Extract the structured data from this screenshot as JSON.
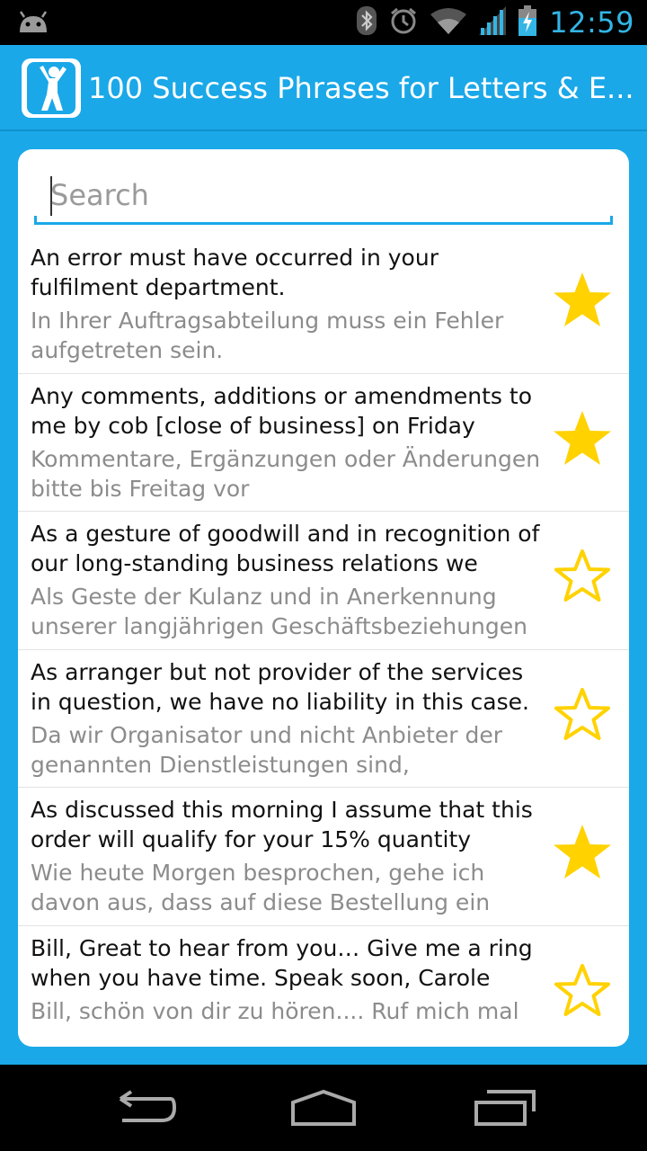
{
  "status_bar": {
    "time": "12:59",
    "icons": [
      "android-icon",
      "bluetooth-icon",
      "alarm-icon",
      "wifi-icon",
      "signal-icon",
      "battery-icon"
    ]
  },
  "action_bar": {
    "title": "100 Success Phrases for Letters & E...",
    "icon": "person-cheering-icon"
  },
  "search": {
    "placeholder": "Search",
    "value": ""
  },
  "phrases": [
    {
      "en": "An error must have occurred in your fulfilment department.",
      "de": "In Ihrer Auftragsabteilung muss ein Fehler aufgetreten sein.",
      "favorite": true
    },
    {
      "en": "Any comments, additions or amendments to me by cob [close of business] on Friday",
      "de": "Kommentare, Ergänzungen oder Änderungen bitte bis Freitag vor",
      "favorite": true
    },
    {
      "en": "As a gesture of goodwill and in recognition of our long-standing business relations we",
      "de": "Als Geste der Kulanz und in Anerkennung unserer langjährigen Geschäftsbeziehungen",
      "favorite": false
    },
    {
      "en": "As arranger but not provider of the services in question, we have no liability in this case.",
      "de": "Da wir Organisator und nicht Anbieter der genannten Dienstleistungen sind,",
      "favorite": false
    },
    {
      "en": "As discussed this morning I assume that this order will qualify for your 15% quantity",
      "de": "Wie heute Morgen besprochen, gehe ich davon aus, dass auf diese Bestellung ein",
      "favorite": true
    },
    {
      "en": "Bill, Great to hear from you… Give me a ring when you have time. Speak soon, Carole",
      "de": "Bill, schön von dir zu hören.... Ruf mich mal",
      "favorite": false
    }
  ],
  "colors": {
    "accent": "#1aa8e8",
    "star_fill": "#ffd200",
    "star_outline": "#ffd200",
    "status_text": "#33b5e5"
  },
  "nav_bar": {
    "icons": [
      "back-icon",
      "home-icon",
      "recent-apps-icon"
    ]
  }
}
